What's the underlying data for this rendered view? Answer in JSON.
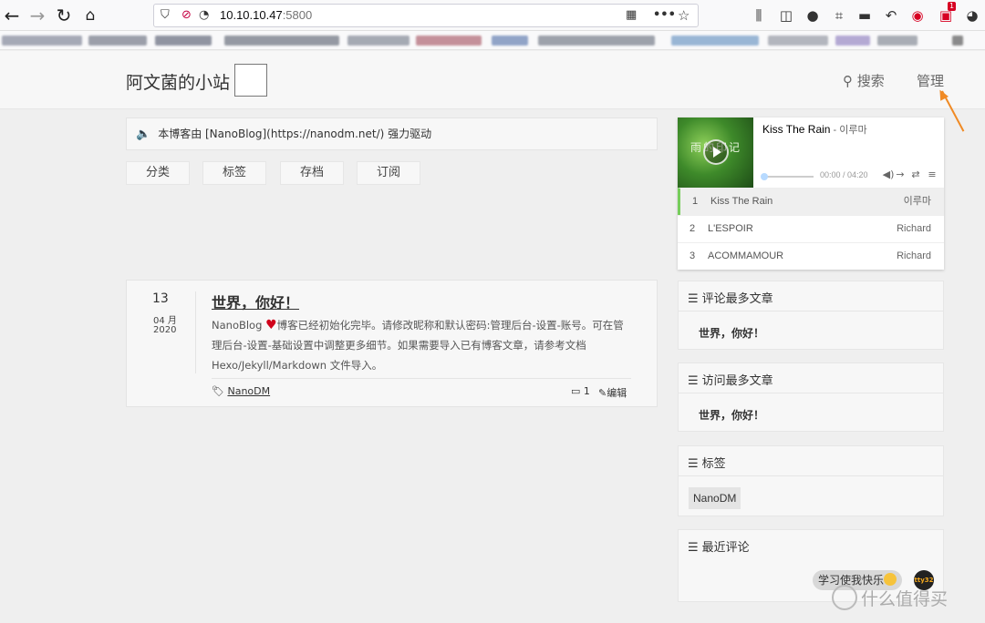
{
  "browser": {
    "url_host": "10.10.10.47",
    "url_port": ":5800",
    "extension_badge": "1",
    "icons": {
      "back": "arrow-left-icon",
      "forward": "arrow-right-icon",
      "reload": "reload-icon",
      "home": "home-icon",
      "shield": "shield-icon",
      "qr": "qr-code-icon",
      "more": "more-icon",
      "star": "bookmark-star-icon"
    }
  },
  "site": {
    "title": "阿文菌的小站",
    "nav": {
      "search": "搜索",
      "admin": "管理"
    }
  },
  "notice": {
    "text": "本博客由 [NanoBlog](https://nanodm.net/) 强力驱动"
  },
  "categories": [
    "分类",
    "标签",
    "存档",
    "订阅"
  ],
  "post": {
    "day": "13",
    "month": "04 月",
    "year": "2020",
    "title": "世界，你好！",
    "excerpt_before": "NanoBlog ",
    "excerpt_after": "博客已经初始化完毕。请修改昵称和默认密码:管理后台-设置-账号。可在管理后台-设置-基础设置中调整更多细节。如果需要导入已有博客文章，请参考文档Hexo/Jekyll/Markdown 文件导入。",
    "tag": "NanoDM",
    "comment_count": "1",
    "edit_label": "编辑"
  },
  "player": {
    "song": "Kiss The Rain",
    "artist": " - 이루마",
    "cover_text": "雨的印记",
    "time": "00:00 / 04:20",
    "progress": 0,
    "tracks": [
      {
        "num": "1",
        "name": "Kiss The Rain",
        "artist": "이루마"
      },
      {
        "num": "2",
        "name": "L'ESPOIR",
        "artist": "Richard"
      },
      {
        "num": "3",
        "name": "ACOMMAMOUR",
        "artist": "Richard"
      }
    ]
  },
  "widgets": {
    "most_commented": {
      "title": "评论最多文章",
      "item": "世界，你好！"
    },
    "most_visited": {
      "title": "访问最多文章",
      "item": "世界，你好！"
    },
    "tags": {
      "title": "标签",
      "item": "NanoDM"
    },
    "recent_comments": {
      "title": "最近评论"
    }
  },
  "chat": {
    "text": "学习使我快乐",
    "avatar": "tty32"
  },
  "watermark": {
    "text": "什么值得买"
  },
  "colors": {
    "accent": "#f08a24",
    "active_track": "#76cd5b",
    "heart": "#d0021b"
  }
}
